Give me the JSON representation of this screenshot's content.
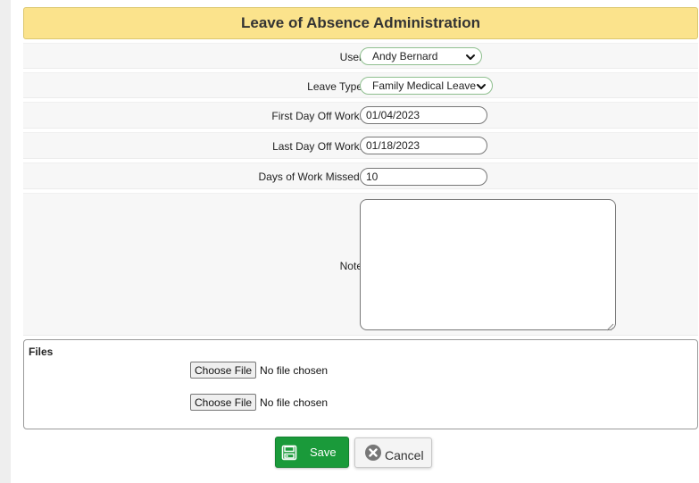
{
  "header": {
    "title": "Leave of Absence Administration"
  },
  "form": {
    "user": {
      "label": "User",
      "value": "Andy Bernard"
    },
    "leave_type": {
      "label": "Leave Type",
      "value": "Family Medical Leave"
    },
    "first_day": {
      "label": "First Day Off Work:",
      "value": "01/04/2023"
    },
    "last_day": {
      "label": "Last Day Off Work:",
      "value": "01/18/2023"
    },
    "days_missed": {
      "label": "Days of Work Missed:",
      "value": "10"
    },
    "note": {
      "label": "Note",
      "value": ""
    }
  },
  "files": {
    "title": "Files",
    "inputs": [
      {
        "button_label": "Choose File",
        "status": "No file chosen"
      },
      {
        "button_label": "Choose File",
        "status": "No file chosen"
      }
    ]
  },
  "actions": {
    "save_label": "Save",
    "cancel_label": "Cancel"
  },
  "colors": {
    "header_bg": "#fbe38c",
    "save_green": "#1a9a3a",
    "row_bg": "#f7f7f7"
  },
  "icons": {
    "save": "floppy-disk-icon",
    "cancel": "x-circle-icon",
    "dropdown": "chevron-down-icon"
  }
}
